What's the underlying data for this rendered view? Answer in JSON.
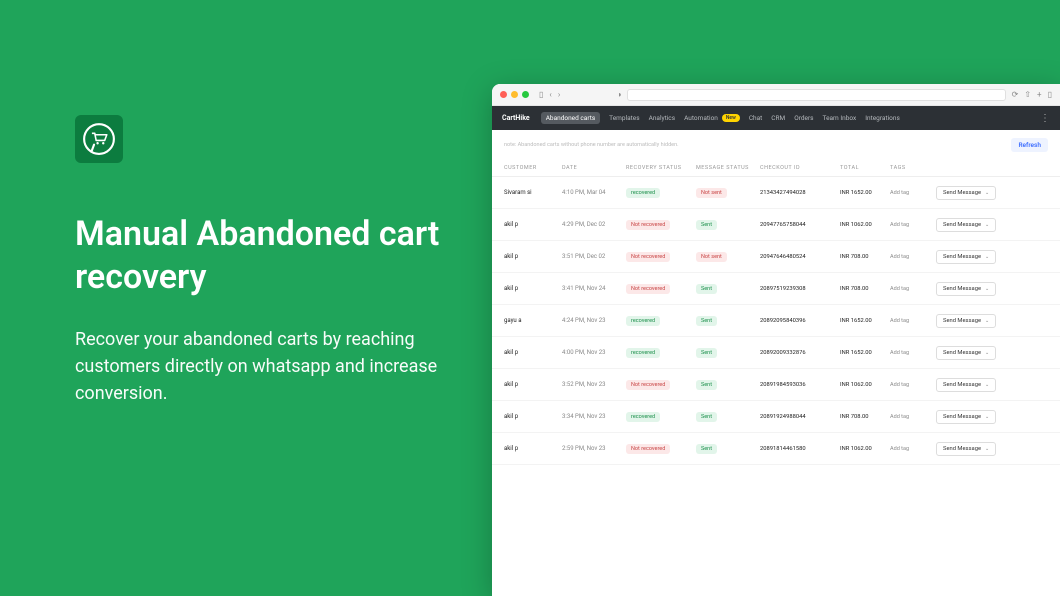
{
  "hero": {
    "title": "Manual Abandoned cart recovery",
    "subtitle": "Recover your abandoned carts by reaching customers directly on whatsapp and increase conversion."
  },
  "nav": {
    "brand": "CartHike",
    "items": [
      "Abandoned carts",
      "Templates",
      "Analytics",
      "Automation",
      "Chat",
      "CRM",
      "Orders",
      "Team Inbox",
      "Integrations"
    ],
    "new_label": "New"
  },
  "note": "note: Abandoned carts without phone number are automatically hidden.",
  "refresh": "Refresh",
  "columns": {
    "customer": "CUSTOMER",
    "date": "DATE",
    "recovery": "RECOVERY STATUS",
    "message": "MESSAGE STATUS",
    "checkout": "CHECKOUT ID",
    "total": "TOTAL",
    "tags": "TAGS"
  },
  "labels": {
    "recovered": "recovered",
    "not_recovered": "Not recovered",
    "sent": "Sent",
    "not_sent": "Not sent",
    "add_tag": "Add tag",
    "send": "Send Message"
  },
  "rows": [
    {
      "customer": "Sivaram si",
      "date": "4:10 PM, Mar 04",
      "recovery": "recovered",
      "message": "not_sent",
      "checkout": "21343427494028",
      "total": "INR 1652.00"
    },
    {
      "customer": "akil p",
      "date": "4:29 PM, Dec 02",
      "recovery": "not_recovered",
      "message": "sent",
      "checkout": "20947765758044",
      "total": "INR 1062.00"
    },
    {
      "customer": "akil p",
      "date": "3:51 PM, Dec 02",
      "recovery": "not_recovered",
      "message": "not_sent",
      "checkout": "20947646480524",
      "total": "INR 708.00"
    },
    {
      "customer": "akil p",
      "date": "3:41 PM, Nov 24",
      "recovery": "not_recovered",
      "message": "sent",
      "checkout": "20897519239308",
      "total": "INR 708.00"
    },
    {
      "customer": "gayu a",
      "date": "4:24 PM, Nov 23",
      "recovery": "recovered",
      "message": "sent",
      "checkout": "20892095840396",
      "total": "INR 1652.00"
    },
    {
      "customer": "akil p",
      "date": "4:00 PM, Nov 23",
      "recovery": "recovered",
      "message": "sent",
      "checkout": "20892009332876",
      "total": "INR 1652.00"
    },
    {
      "customer": "akil p",
      "date": "3:52 PM, Nov 23",
      "recovery": "not_recovered",
      "message": "sent",
      "checkout": "20891984593036",
      "total": "INR 1062.00"
    },
    {
      "customer": "akil p",
      "date": "3:34 PM, Nov 23",
      "recovery": "recovered",
      "message": "sent",
      "checkout": "20891924988044",
      "total": "INR 708.00"
    },
    {
      "customer": "akil p",
      "date": "2:59 PM, Nov 23",
      "recovery": "not_recovered",
      "message": "sent",
      "checkout": "20891814461580",
      "total": "INR 1062.00"
    }
  ]
}
